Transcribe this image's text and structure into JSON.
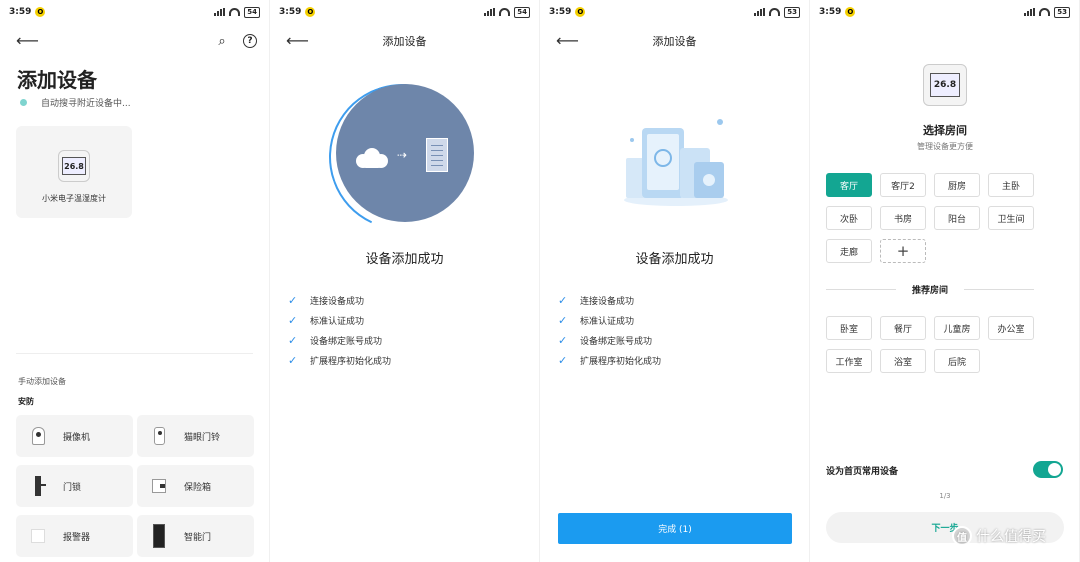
{
  "status_bar": [
    {
      "time": "3:59",
      "notif": "O",
      "battery": "54"
    },
    {
      "time": "3:59",
      "notif": "O",
      "battery": "54"
    },
    {
      "time": "3:59",
      "notif": "O",
      "battery": "53"
    },
    {
      "time": "3:59",
      "notif": "O",
      "battery": "53"
    }
  ],
  "screen1": {
    "title": "添加设备",
    "scanning_text": "自动搜寻附近设备中...",
    "found_device": {
      "name": "小米电子温湿度计",
      "display": "26.8"
    },
    "manual_label": "手动添加设备",
    "section_label": "安防",
    "categories": [
      {
        "label": "摄像机",
        "icon": "camera-icon"
      },
      {
        "label": "猫眼门铃",
        "icon": "peephole-doorbell-icon"
      },
      {
        "label": "门锁",
        "icon": "door-lock-icon"
      },
      {
        "label": "保险箱",
        "icon": "safe-icon"
      },
      {
        "label": "报警器",
        "icon": "alarm-icon"
      },
      {
        "label": "智能门",
        "icon": "smart-door-icon"
      }
    ]
  },
  "screen2": {
    "nav_title": "添加设备",
    "success_title": "设备添加成功",
    "steps": [
      "连接设备成功",
      "标准认证成功",
      "设备绑定账号成功",
      "扩展程序初始化成功"
    ]
  },
  "screen3": {
    "nav_title": "添加设备",
    "success_title": "设备添加成功",
    "steps": [
      "连接设备成功",
      "标准认证成功",
      "设备绑定账号成功",
      "扩展程序初始化成功"
    ],
    "done_button": "完成 (1)"
  },
  "screen4": {
    "device_display": "26.8",
    "title": "选择房间",
    "subtitle": "管理设备更方便",
    "rooms": [
      "客厅",
      "客厅2",
      "厨房",
      "主卧",
      "次卧",
      "书房",
      "阳台",
      "卫生间",
      "走廊"
    ],
    "selected_room": "客厅",
    "add_room": "+",
    "recommended_label": "推荐房间",
    "recommended": [
      "卧室",
      "餐厅",
      "儿童房",
      "办公室",
      "工作室",
      "浴室",
      "后院"
    ],
    "favorite_label": "设为首页常用设备",
    "favorite_on": true,
    "page_indicator": "1/3",
    "next_button": "下一步"
  },
  "watermark": {
    "logo": "值",
    "text": "什么值得买"
  },
  "colors": {
    "accent_green": "#13a692",
    "accent_blue": "#1b9bf0",
    "circle": "#6e86aa"
  }
}
